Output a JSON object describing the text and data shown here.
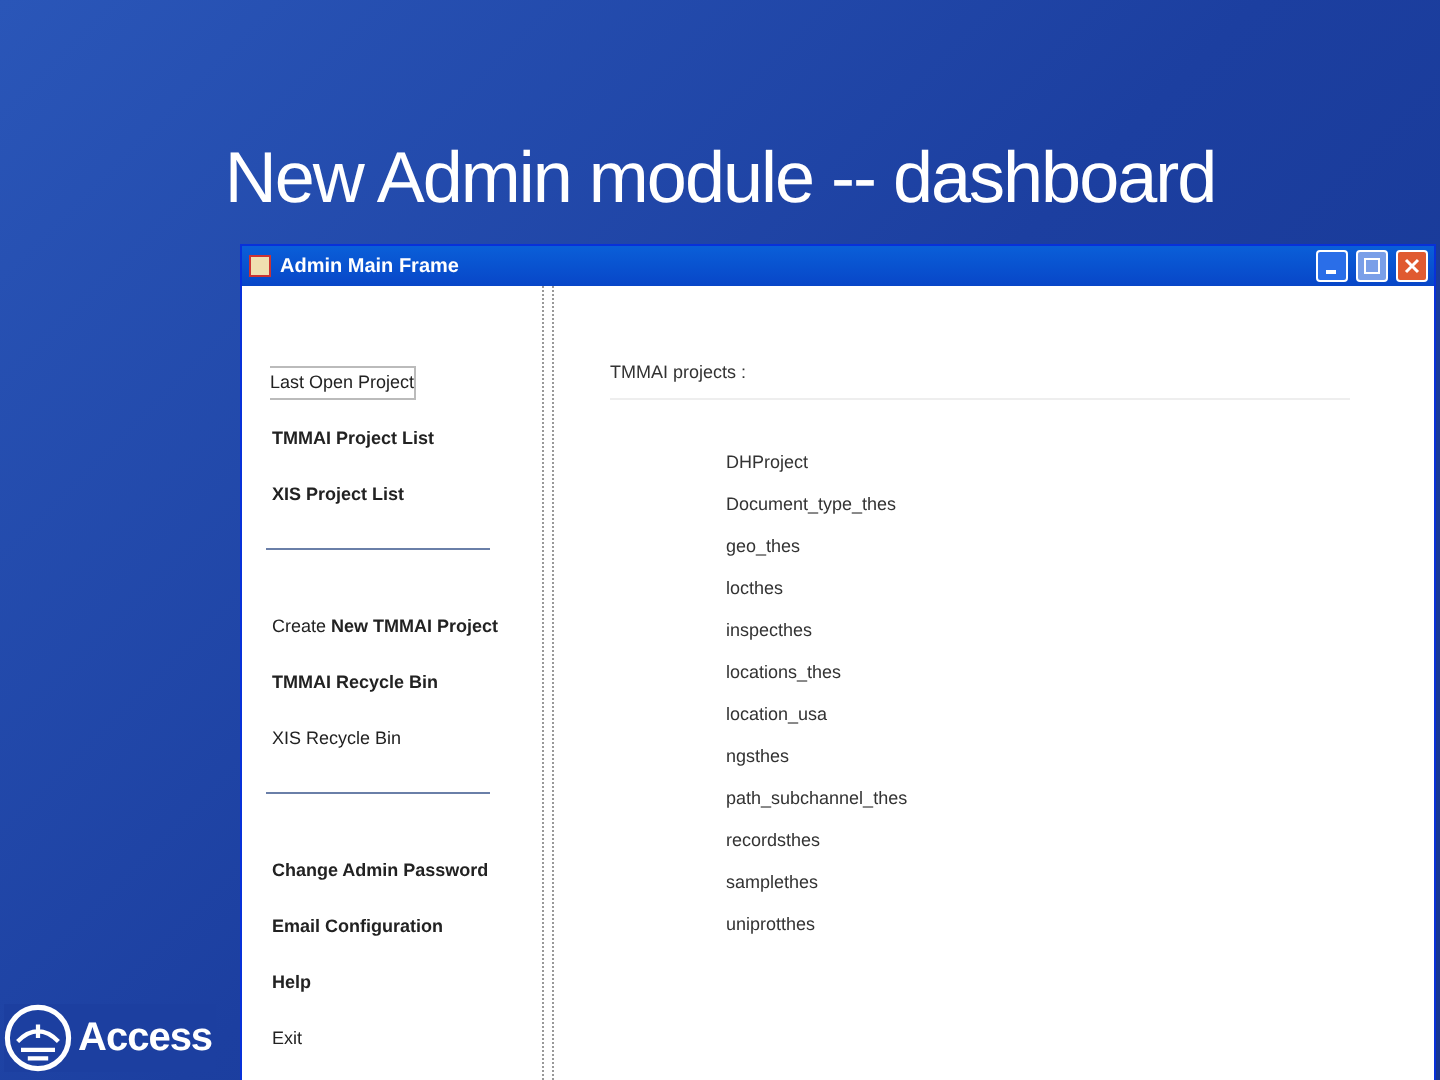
{
  "slide_title": "New Admin module -- dashboard",
  "window": {
    "title": "Admin Main Frame"
  },
  "sidebar": {
    "groups": [
      [
        {
          "label": "Last Open Project",
          "bold": false,
          "focused": true
        },
        {
          "label": "TMMAI Project List",
          "bold": true,
          "focused": false
        },
        {
          "label": "XIS Project List",
          "bold": true,
          "focused": false
        }
      ],
      [
        {
          "label": "Create **New TMMAI Project**",
          "bold": false,
          "focused": false
        },
        {
          "label": "TMMAI Recycle Bin",
          "bold": true,
          "focused": false
        },
        {
          "label": "XIS Recycle Bin",
          "bold": false,
          "focused": false
        }
      ],
      [
        {
          "label": "Change Admin Password",
          "bold": true,
          "focused": false
        },
        {
          "label": "Email Configuration",
          "bold": true,
          "focused": false
        },
        {
          "label": "Help",
          "bold": true,
          "focused": false
        },
        {
          "label": "Exit",
          "bold": false,
          "focused": false
        }
      ]
    ]
  },
  "projects": {
    "heading": "TMMAI projects :",
    "items": [
      "DHProject",
      "Document_type_thes",
      "geo_thes",
      "locthes",
      "inspecthes",
      "locations_thes",
      "location_usa",
      "ngsthes",
      "path_subchannel_thes",
      "recordsthes",
      "samplethes",
      "uniprotthes"
    ]
  },
  "logo": {
    "text": "Access"
  }
}
